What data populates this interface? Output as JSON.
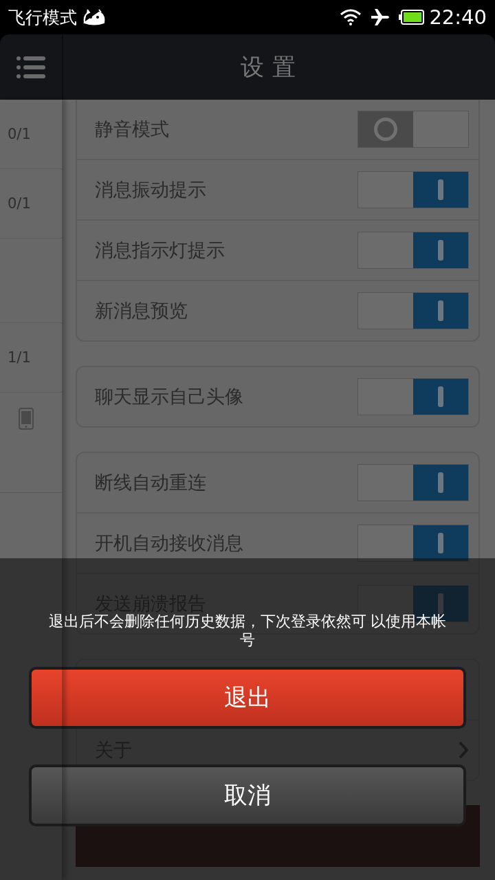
{
  "status_bar": {
    "mode": "飞行模式",
    "time": "22:40"
  },
  "header": {
    "title": "设置"
  },
  "sidebar": {
    "items": [
      {
        "kind": "count",
        "text": "0/1"
      },
      {
        "kind": "count",
        "text": "0/1"
      },
      {
        "kind": "blank"
      },
      {
        "kind": "count",
        "text": "1/1"
      },
      {
        "kind": "phone"
      }
    ]
  },
  "groups": [
    {
      "items": [
        {
          "kind": "toggle",
          "label": "静音模式",
          "on": false
        },
        {
          "kind": "toggle",
          "label": "消息振动提示",
          "on": true
        },
        {
          "kind": "toggle",
          "label": "消息指示灯提示",
          "on": true
        },
        {
          "kind": "toggle",
          "label": "新消息预览",
          "on": true
        }
      ]
    },
    {
      "items": [
        {
          "kind": "toggle",
          "label": "聊天显示自己头像",
          "on": true
        }
      ]
    },
    {
      "items": [
        {
          "kind": "toggle",
          "label": "断线自动重连",
          "on": true
        },
        {
          "kind": "toggle",
          "label": "开机自动接收消息",
          "on": true
        },
        {
          "kind": "toggle",
          "label": "发送崩溃报告",
          "on": true
        }
      ]
    },
    {
      "items": [
        {
          "kind": "blank"
        },
        {
          "kind": "link",
          "label": "关于"
        }
      ]
    }
  ],
  "dialog": {
    "message": "退出后不会删除任何历史数据，下次登录依然可 以使用本帐号",
    "buttons": [
      {
        "label": "退出",
        "kind": "danger"
      },
      {
        "label": "取消",
        "kind": "normal"
      }
    ]
  }
}
